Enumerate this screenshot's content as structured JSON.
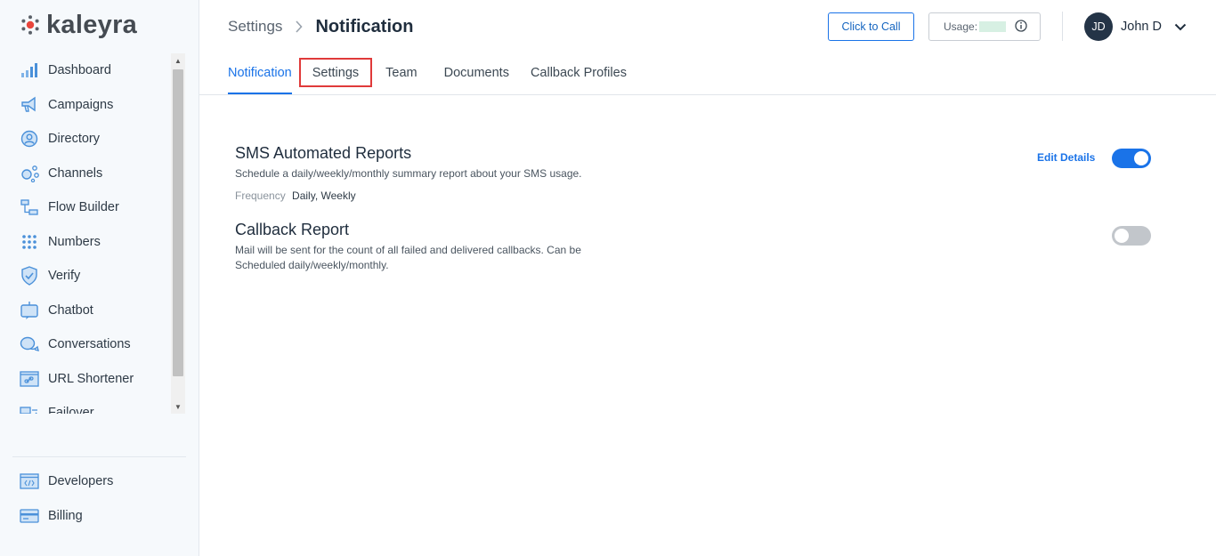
{
  "app": {
    "logo_text": "kaleyra"
  },
  "sidebar": {
    "items": [
      {
        "label": "Dashboard",
        "icon": "bar-chart-icon"
      },
      {
        "label": "Campaigns",
        "icon": "megaphone-icon"
      },
      {
        "label": "Directory",
        "icon": "user-circle-icon"
      },
      {
        "label": "Channels",
        "icon": "channels-icon"
      },
      {
        "label": "Flow Builder",
        "icon": "flow-icon"
      },
      {
        "label": "Numbers",
        "icon": "keypad-icon"
      },
      {
        "label": "Verify",
        "icon": "shield-check-icon"
      },
      {
        "label": "Chatbot",
        "icon": "robot-icon"
      },
      {
        "label": "Conversations",
        "icon": "chat-bubbles-icon"
      },
      {
        "label": "URL Shortener",
        "icon": "link-icon"
      },
      {
        "label": "Failover",
        "icon": "failover-icon"
      }
    ],
    "bottom_items": [
      {
        "label": "Developers",
        "icon": "code-icon"
      },
      {
        "label": "Billing",
        "icon": "card-icon"
      }
    ]
  },
  "header": {
    "breadcrumb_parent": "Settings",
    "breadcrumb_current": "Notification",
    "click_to_call_label": "Click to Call",
    "usage_label": "Usage:",
    "user_initials": "JD",
    "user_name": "John D"
  },
  "tabs": [
    {
      "label": "Notification",
      "active": true
    },
    {
      "label": "Settings",
      "highlighted": true
    },
    {
      "label": "Team"
    },
    {
      "label": "Documents"
    },
    {
      "label": "Callback Profiles"
    }
  ],
  "reports": {
    "sms": {
      "title": "SMS Automated Reports",
      "description": "Schedule a daily/weekly/monthly summary report about your SMS usage.",
      "frequency_label": "Frequency",
      "frequency_value": "Daily, Weekly",
      "edit_label": "Edit Details",
      "enabled": true
    },
    "callback": {
      "title": "Callback Report",
      "description": "Mail will be sent for the count of all failed and delivered callbacks. Can be Scheduled daily/weekly/monthly.",
      "enabled": false
    }
  },
  "colors": {
    "accent": "#1a73e8",
    "highlight_border": "#e03a3a",
    "avatar_bg": "#243447",
    "logo_red": "#e8453c"
  }
}
